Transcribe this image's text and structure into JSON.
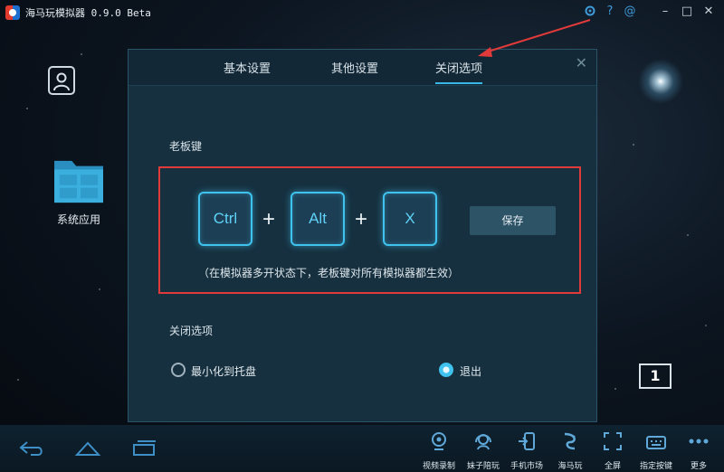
{
  "window": {
    "title": "海马玩模拟器 0.9.0 Beta",
    "icons": [
      "gear-icon",
      "help-icon",
      "at-icon",
      "minimize-icon",
      "maximize-icon",
      "close-icon"
    ],
    "help_glyph": "?",
    "at_glyph": "@"
  },
  "desktop": {
    "system_apps_label": "系统应用",
    "badge": "1"
  },
  "dialog": {
    "tabs": [
      {
        "label": "基本设置",
        "active": false
      },
      {
        "label": "其他设置",
        "active": false
      },
      {
        "label": "关闭选项",
        "active": true
      }
    ],
    "boss_key": {
      "title": "老板键",
      "keys": [
        "Ctrl",
        "Alt",
        "X"
      ],
      "plus": "+",
      "save_label": "保存",
      "hint": "（在模拟器多开状态下，老板键对所有模拟器都生效）"
    },
    "close_options": {
      "title": "关闭选项",
      "options": [
        {
          "label": "最小化到托盘",
          "checked": false
        },
        {
          "label": "退出",
          "checked": true
        }
      ]
    }
  },
  "bottombar": {
    "nav": [
      "back-icon",
      "home-icon",
      "recent-apps-icon"
    ],
    "tools": [
      {
        "label": "视频录制",
        "icon": "camera-icon"
      },
      {
        "label": "妹子陪玩",
        "icon": "headset-icon"
      },
      {
        "label": "手机市场",
        "icon": "market-icon"
      },
      {
        "label": "海马玩",
        "icon": "haimawan-icon"
      },
      {
        "label": "全屏",
        "icon": "fullscreen-icon"
      },
      {
        "label": "指定按键",
        "icon": "keyboard-icon"
      },
      {
        "label": "更多",
        "icon": "more-icon"
      }
    ]
  },
  "colors": {
    "accent": "#3fc2ee",
    "highlight_border": "#e03a3a",
    "dialog_bg": "#16303f"
  }
}
